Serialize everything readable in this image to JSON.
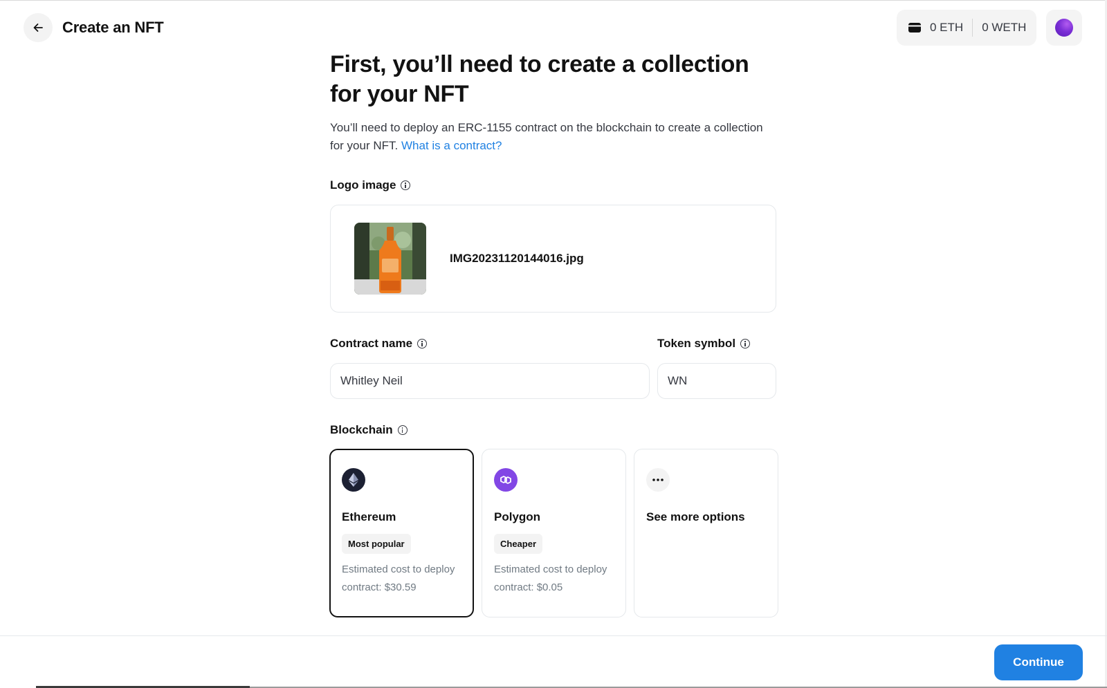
{
  "header": {
    "title": "Create an NFT",
    "back_icon": "arrow-left-icon"
  },
  "wallet": {
    "eth_balance": "0 ETH",
    "weth_balance": "0 WETH",
    "wallet_icon": "wallet-icon"
  },
  "main": {
    "headline": "First, you’ll need to create a collection for your NFT",
    "intro_text": "You’ll need to deploy an ERC-1155 contract on the blockchain to create a collection for your NFT.",
    "intro_link": "What is a contract?"
  },
  "logo": {
    "label": "Logo image",
    "filename": "IMG20231120144016.jpg"
  },
  "contract": {
    "name_label": "Contract name",
    "name_value": "Whitley Neil",
    "symbol_label": "Token symbol",
    "symbol_value": "WN"
  },
  "blockchain": {
    "label": "Blockchain",
    "options": [
      {
        "name": "Ethereum",
        "badge": "Most popular",
        "cost": "Estimated cost to deploy contract: $30.59",
        "icon": "ethereum-icon",
        "selected": true
      },
      {
        "name": "Polygon",
        "badge": "Cheaper",
        "cost": "Estimated cost to deploy contract: $0.05",
        "icon": "polygon-icon",
        "selected": false
      },
      {
        "name": "See more options",
        "icon": "more-options-icon",
        "selected": false
      }
    ]
  },
  "footer": {
    "continue_label": "Continue"
  },
  "colors": {
    "accent": "#2081e2",
    "text": "#121212",
    "muted": "#707a83",
    "border": "#e5e8eb",
    "polygon": "#8247e5",
    "ethereum_bg": "#1c2033"
  }
}
